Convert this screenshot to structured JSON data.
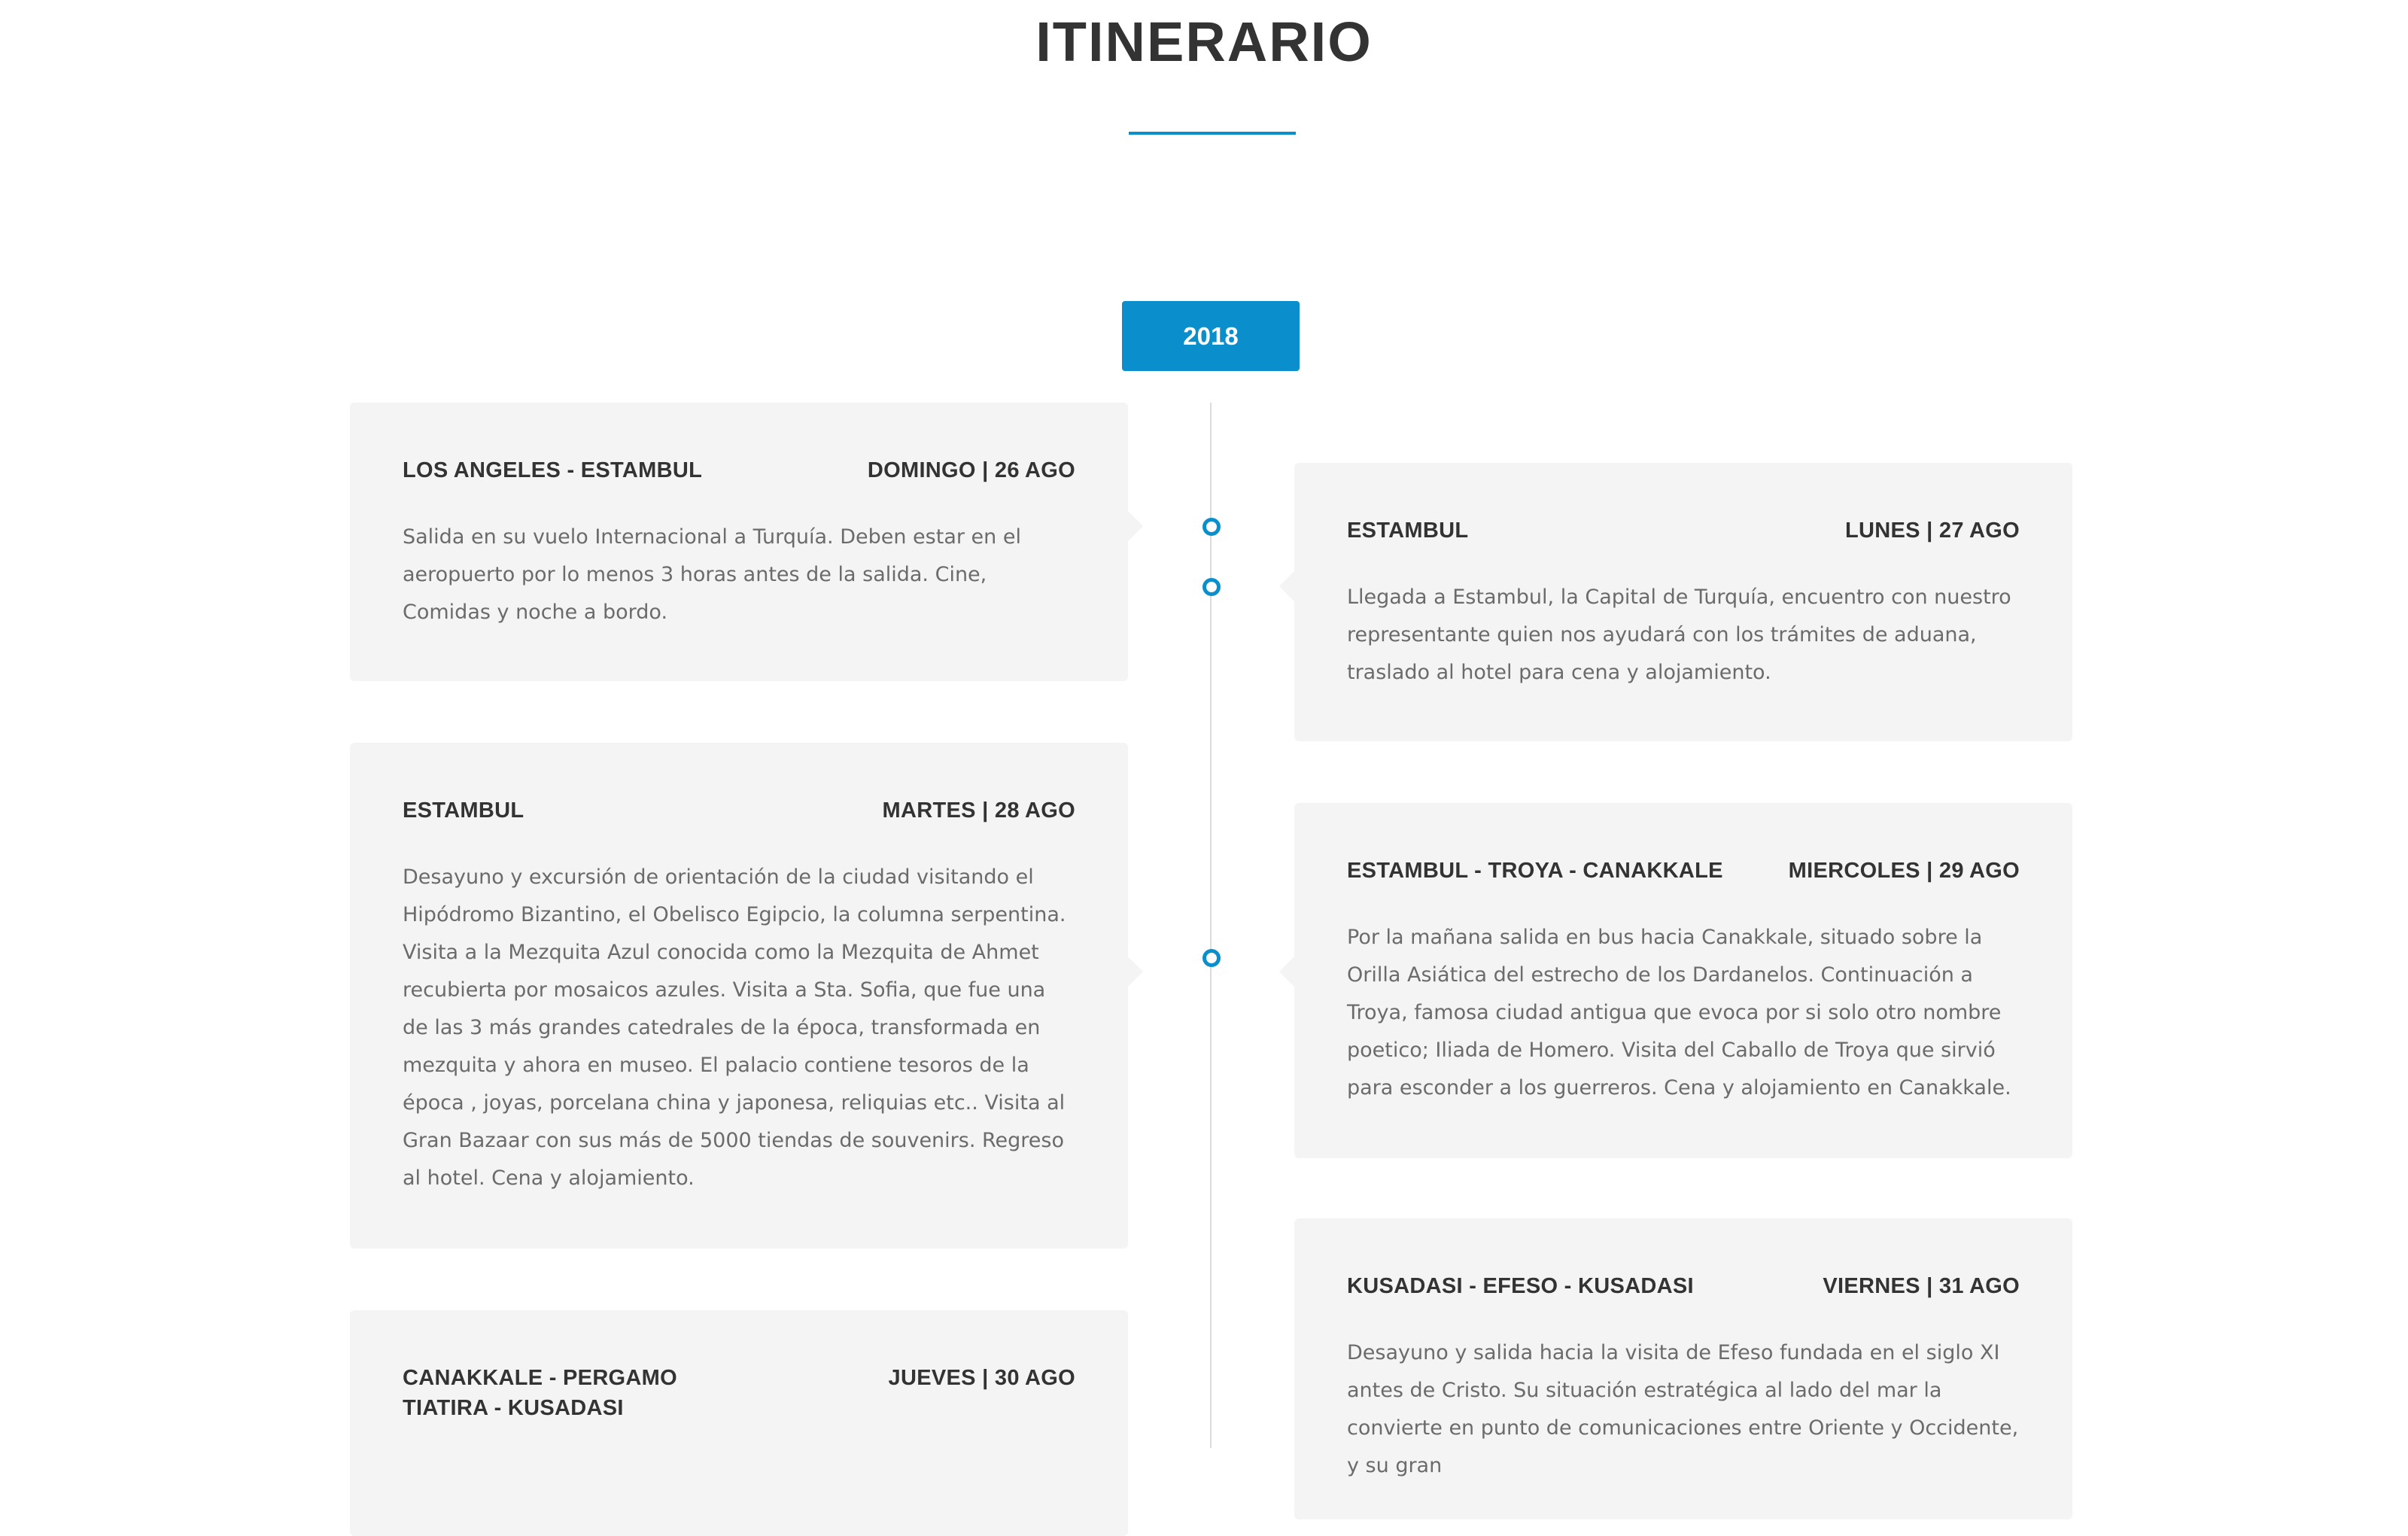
{
  "page": {
    "title": "ITINERARIO"
  },
  "timeline": {
    "year": "2018",
    "entries": [
      {
        "place": "LOS ANGELES - ESTAMBUL",
        "date": "DOMINGO | 26 AGO",
        "text": "Salida en su vuelo Internacional a Turquía. Deben estar en el aeropuerto por lo menos 3 horas antes de la salida. Cine, Comidas y noche a bordo."
      },
      {
        "place": "ESTAMBUL",
        "date": "LUNES | 27 AGO",
        "text": "Llegada a Estambul, la Capital de Turquía, encuentro con nuestro representante quien nos ayudará con los trámites de aduana, traslado al hotel para cena y alojamiento."
      },
      {
        "place": "ESTAMBUL",
        "date": "MARTES | 28 AGO",
        "text": "Desayuno y excursión de orientación de la ciudad visitando el Hipódromo Bizantino, el Obelisco Egipcio, la columna serpentina. Visita a la Mezquita Azul conocida como la Mezquita de Ahmet recubierta por mosaicos azules. Visita a Sta. Sofia, que fue una de las 3 más grandes catedrales de la época, transformada en mezquita y ahora en museo. El palacio contiene tesoros de la época , joyas, porcelana china y japonesa, reliquias etc.. Visita al Gran Bazaar con sus más de 5000 tiendas de souvenirs. Regreso al hotel. Cena y alojamiento."
      },
      {
        "place": "ESTAMBUL - TROYA - CANAKKALE",
        "date": "MIERCOLES | 29 AGO",
        "text": "Por la mañana salida en bus hacia Canakkale, situado sobre la Orilla Asiática del estrecho de los Dardanelos. Continuación a Troya, famosa ciudad antigua que evoca por si solo otro nombre poetico; Iliada de Homero. Visita del Caballo de Troya que sirvió para esconder a los guerreros. Cena y alojamiento en Canakkale."
      },
      {
        "place": "CANAKKALE - PERGAMO\nTIATIRA - KUSADASI",
        "date": "JUEVES | 30 AGO",
        "text": ""
      },
      {
        "place": "KUSADASI - EFESO - KUSADASI",
        "date": "VIERNES | 31 AGO",
        "text": "Desayuno y salida hacia la visita de Efeso fundada en el siglo XI antes de Cristo. Su situación estratégica al lado del mar la convierte en punto de comunicaciones entre Oriente y Occidente, y su gran"
      }
    ]
  },
  "colors": {
    "accent": "#0a8fcc",
    "card": "#f4f4f4",
    "heading": "#333333",
    "body": "#6b6b6b"
  }
}
